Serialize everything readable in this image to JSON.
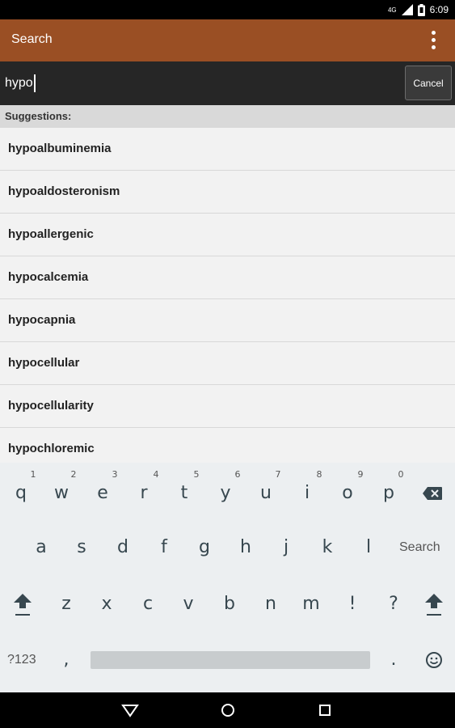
{
  "status_bar": {
    "network": "4G",
    "time": "6:09"
  },
  "app_bar": {
    "title": "Search",
    "overflow_icon": "overflow-menu-icon"
  },
  "search": {
    "value": "hypo",
    "cancel_label": "Cancel"
  },
  "suggestions": {
    "header": "Suggestions:",
    "items": [
      "hypoalbuminemia",
      "hypoaldosteronism",
      "hypoallergenic",
      "hypocalcemia",
      "hypocapnia",
      "hypocellular",
      "hypocellularity",
      "hypochloremic"
    ]
  },
  "keyboard": {
    "row1": [
      "q",
      "w",
      "e",
      "r",
      "t",
      "y",
      "u",
      "i",
      "o",
      "p"
    ],
    "row1_hints": [
      "1",
      "2",
      "3",
      "4",
      "5",
      "6",
      "7",
      "8",
      "9",
      "0"
    ],
    "row2": [
      "a",
      "s",
      "d",
      "f",
      "g",
      "h",
      "j",
      "k",
      "l"
    ],
    "row2_action": "Search",
    "row3": [
      "z",
      "x",
      "c",
      "v",
      "b",
      "n",
      "m",
      "!",
      "?"
    ],
    "symbols_label": "?123",
    "comma": ",",
    "period": "."
  },
  "colors": {
    "app_bar": "#9a4f24",
    "search_bar": "#262626",
    "keyboard": "#eceff1"
  }
}
